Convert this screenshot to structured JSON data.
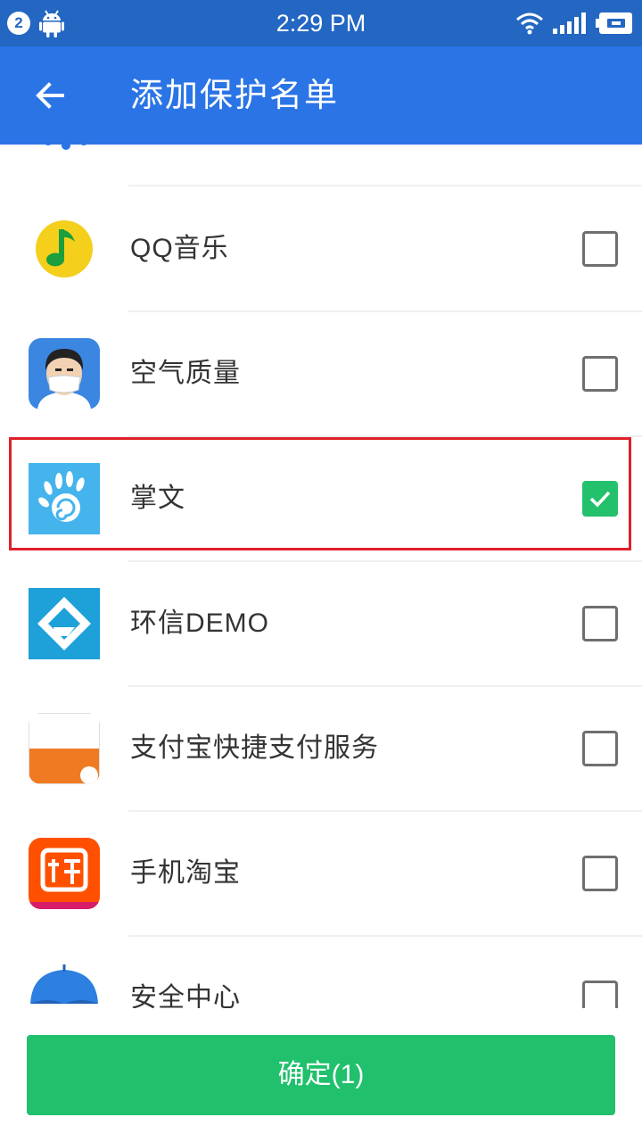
{
  "status_bar": {
    "notification_count": "2",
    "time": "2:29 PM",
    "icons": [
      "android-icon",
      "wifi-icon",
      "signal-icon",
      "battery-icon"
    ]
  },
  "app_bar": {
    "back_icon": "arrow-left-icon",
    "title": "添加保护名单",
    "color": "#2b74e6"
  },
  "apps": [
    {
      "name": "QQ音乐",
      "icon": "qq-music-icon",
      "checked": false
    },
    {
      "name": "空气质量",
      "icon": "air-quality-icon",
      "checked": false
    },
    {
      "name": "掌文",
      "icon": "zhangwen-icon",
      "checked": true
    },
    {
      "name": "环信DEMO",
      "icon": "huanxin-demo-icon",
      "checked": false
    },
    {
      "name": "支付宝快捷支付服务",
      "icon": "alipay-quickpay-icon",
      "checked": false
    },
    {
      "name": "手机淘宝",
      "icon": "taobao-icon",
      "checked": false
    },
    {
      "name": "安全中心",
      "icon": "security-center-icon",
      "checked": false
    }
  ],
  "confirm_button": {
    "label": "确定(1)",
    "color": "#20c06c"
  },
  "colors": {
    "checked": "#23c16c",
    "highlight": "#e0202a"
  }
}
